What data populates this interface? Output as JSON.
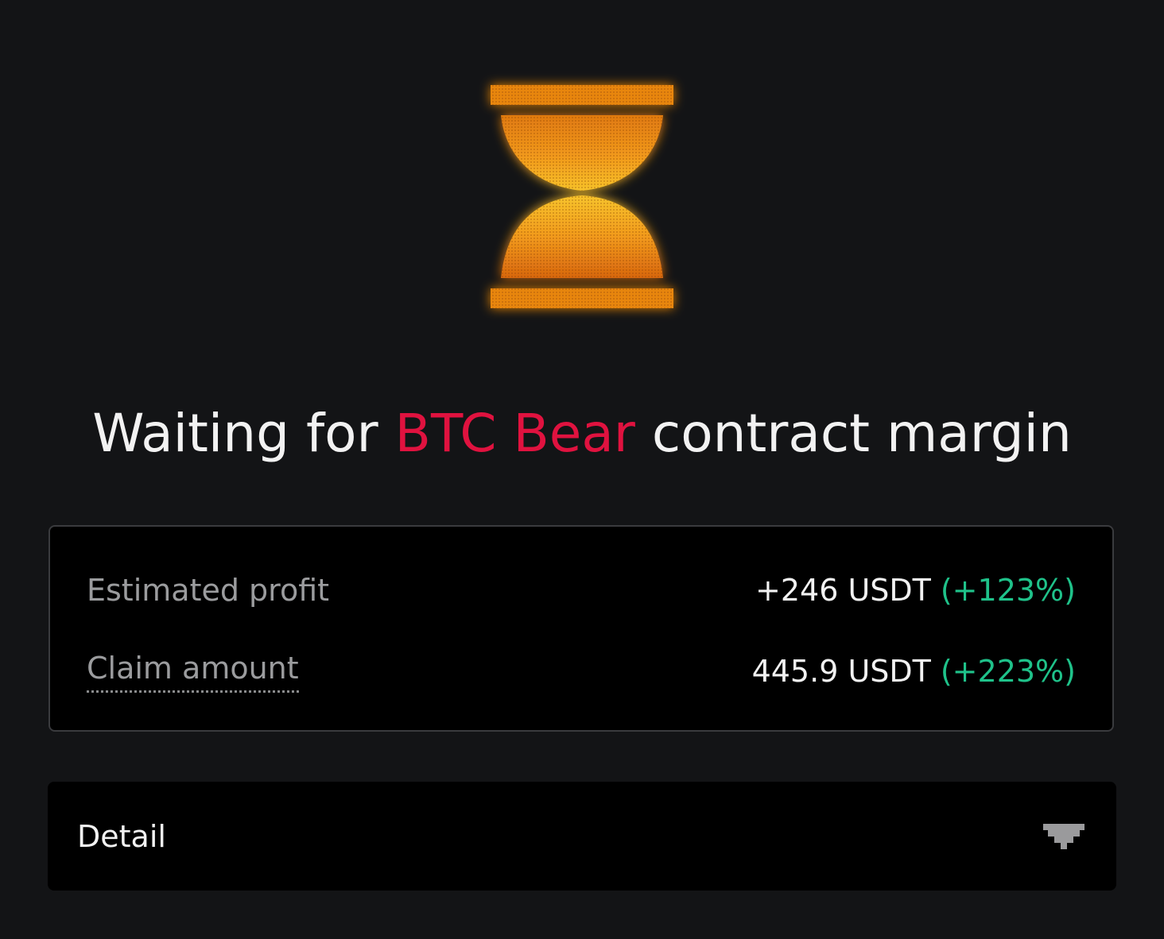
{
  "title": {
    "prefix": "Waiting for ",
    "highlight": "BTC Bear",
    "suffix": " contract margin"
  },
  "summary": {
    "estimated_profit": {
      "label": "Estimated profit",
      "amount": "+246 USDT",
      "percent": "(+123%)"
    },
    "claim_amount": {
      "label": "Claim amount",
      "amount": "445.9 USDT",
      "percent": "(+223%)"
    }
  },
  "detail": {
    "label": "Detail"
  },
  "icons": {
    "status": "hourglass-icon",
    "expand": "chevron-down-icon"
  },
  "colors": {
    "background": "#131416",
    "accent_red": "#e0123f",
    "positive_green": "#1fc28a",
    "hourglass_orange": "#f5a623"
  }
}
